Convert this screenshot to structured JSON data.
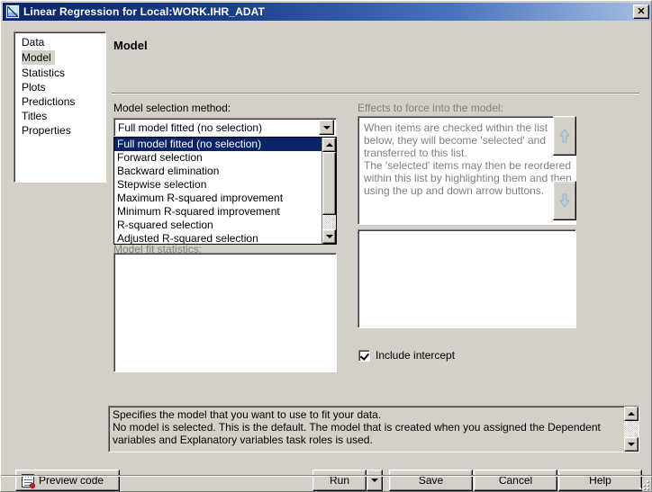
{
  "window": {
    "title": "Linear Regression for Local:WORK.IHR_ADAT",
    "icon": "regression-chart-icon",
    "close_label": "✕"
  },
  "sidebar": {
    "items": [
      {
        "label": "Data",
        "selected": false
      },
      {
        "label": "Model",
        "selected": true
      },
      {
        "label": "Statistics",
        "selected": false
      },
      {
        "label": "Plots",
        "selected": false
      },
      {
        "label": "Predictions",
        "selected": false
      },
      {
        "label": "Titles",
        "selected": false
      },
      {
        "label": "Properties",
        "selected": false
      }
    ]
  },
  "panel": {
    "heading": "Model",
    "model_selection_label": "Model selection method:",
    "model_fit_label": "Model fit statistics:",
    "effects_label": "Effects to force into the model:",
    "combo_value": "Full model fitted (no selection)",
    "dropdown_options": [
      "Full model fitted (no selection)",
      "Forward selection",
      "Backward elimination",
      "Stepwise selection",
      "Maximum R-squared improvement",
      "Minimum R-squared improvement",
      "R-squared selection",
      "Adjusted R-squared selection"
    ],
    "dropdown_selected_index": 0,
    "effects_help_text": "When items are checked within the list below, they will become 'selected' and transferred to this list.\nThe 'selected' items may then be reordered within this list by highlighting them and then using the up and down arrow buttons.",
    "include_intercept_label": "Include intercept",
    "include_intercept_checked": true,
    "move_up_icon": "arrow-up-icon",
    "move_down_icon": "arrow-down-icon"
  },
  "description": {
    "text": "Specifies the model that you want to use to fit your data.\nNo model is selected. This is the default. The model that is created when you assigned the Dependent variables and Explanatory variables task roles is used."
  },
  "footer": {
    "preview_code": "Preview code",
    "run": "Run",
    "save": "Save",
    "cancel": "Cancel",
    "help": "Help"
  },
  "colors": {
    "face": "#d4d0c8",
    "title_start": "#0a246a",
    "title_end": "#a6c0e4",
    "highlight": "#0a246a",
    "disabled_text": "#808080"
  }
}
